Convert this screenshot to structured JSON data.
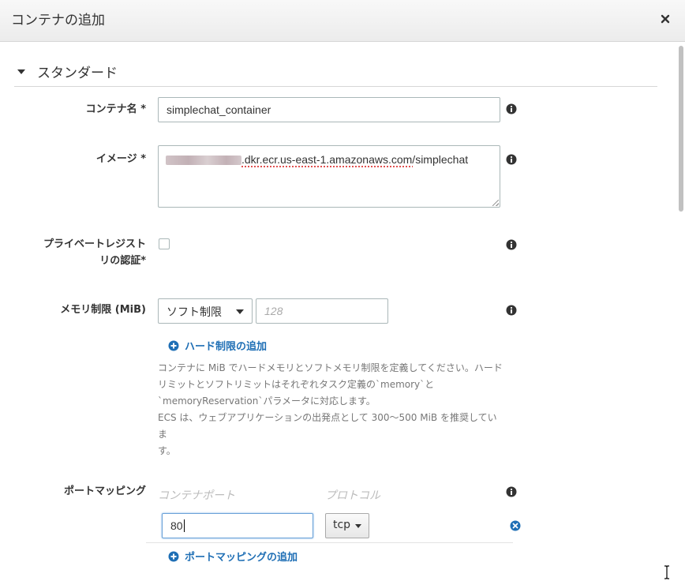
{
  "dialog": {
    "title": "コンテナの追加"
  },
  "section": {
    "title": "スタンダード"
  },
  "fields": {
    "container_name": {
      "label": "コンテナ名 *",
      "value": "simplechat_container"
    },
    "image": {
      "label": "イメージ *",
      "value": ".dkr.ecr.us-east-1.amazonaws.com/simplechat"
    },
    "private_registry": {
      "label_line1": "プライベートレジスト",
      "label_line2": "リの認証*",
      "checked": false
    },
    "memory_limit": {
      "label": "メモリ制限 (MiB)",
      "select_value": "ソフト制限",
      "placeholder": "128",
      "add_link": "ハード制限の追加",
      "help_lines": [
        "コンテナに MiB でハードメモリとソフトメモリ制限を定義してください。ハード",
        "リミットとソフトリミットはそれぞれタスク定義の`memory`と",
        "`memoryReservation`パラメータに対応します。",
        "ECS は、ウェブアプリケーションの出発点として 300～500 MiB を推奨していま",
        "す。"
      ]
    },
    "port_mapping": {
      "label": "ポートマッピング",
      "container_port_header": "コンテナポート",
      "protocol_header": "プロトコル",
      "container_port_value": "80",
      "protocol_value": "tcp",
      "add_link": "ポートマッピングの追加"
    }
  },
  "icons": {
    "close": "close-icon",
    "info": "info-icon",
    "plus": "plus-circle-icon",
    "remove": "remove-circle-icon"
  },
  "colors": {
    "link": "#1f6fb5",
    "focus": "#6aa1d8"
  }
}
